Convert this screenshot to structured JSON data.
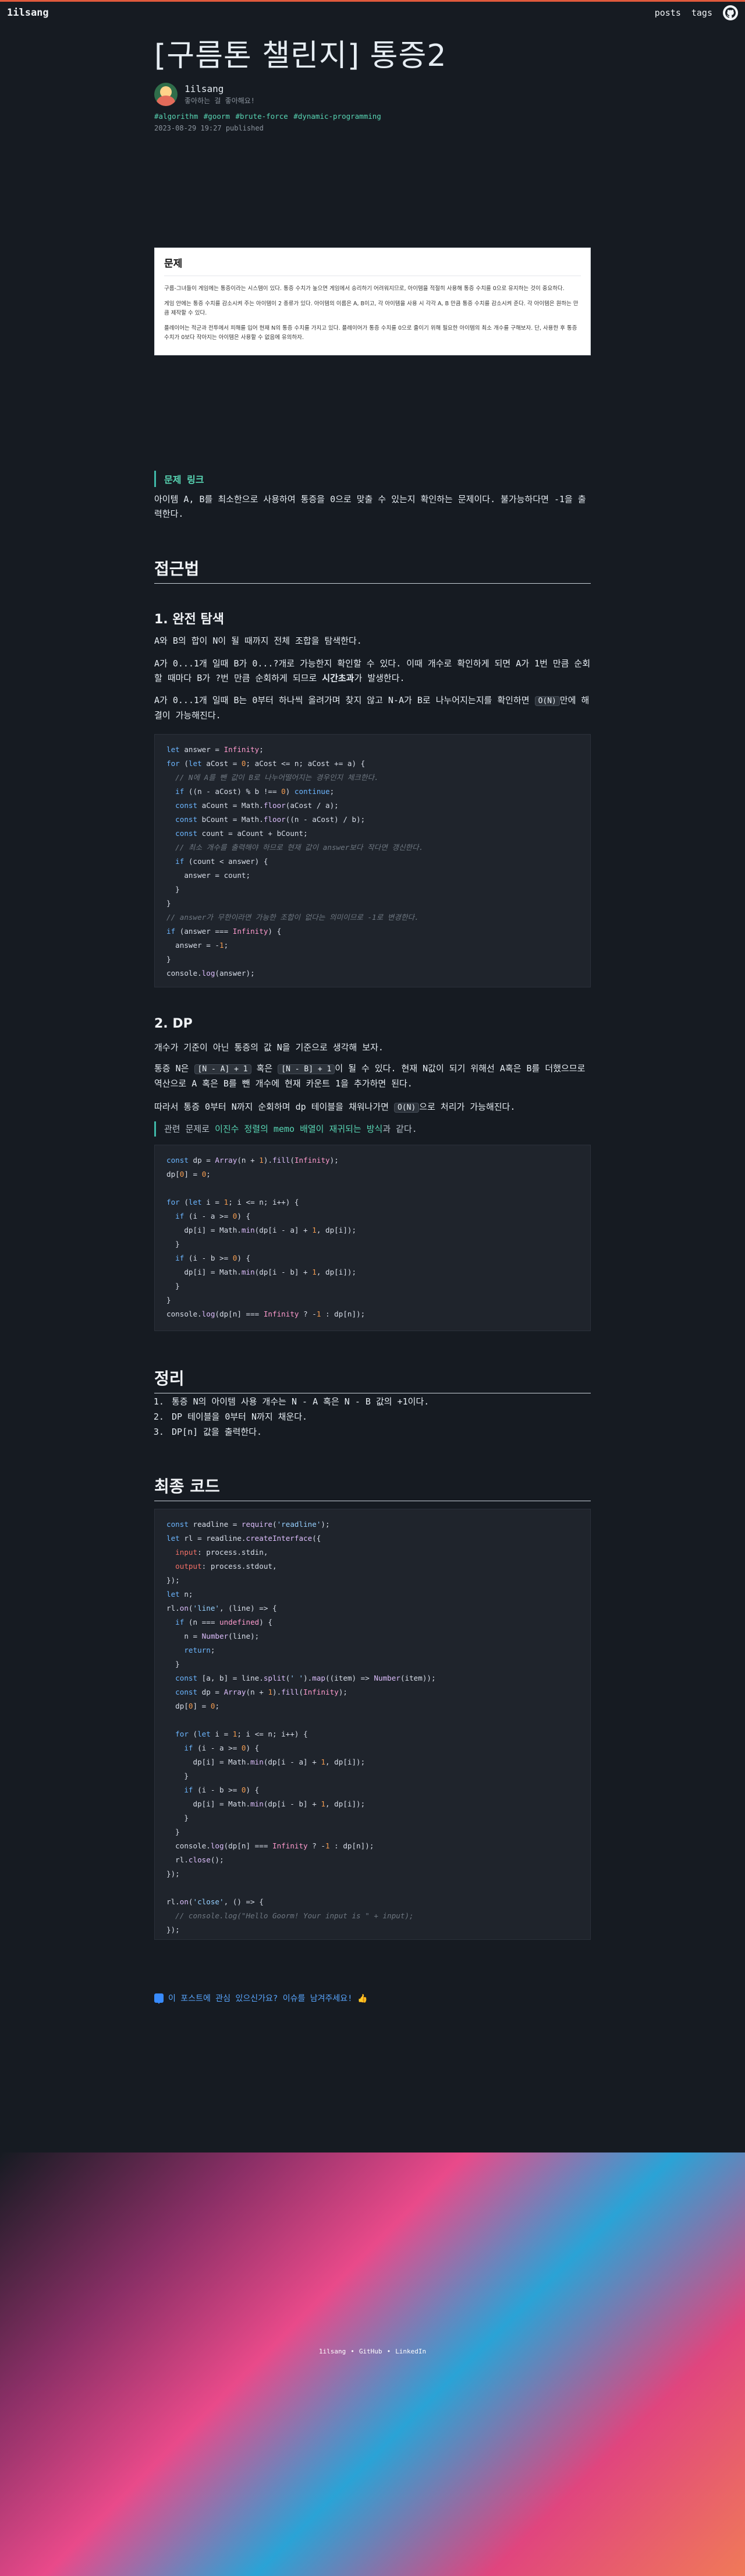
{
  "header": {
    "logo": "1ilsang",
    "nav": [
      "posts",
      "tags"
    ]
  },
  "post": {
    "title": "[구름톤 챌린지] 통증2",
    "author": "1ilsang",
    "author_sub": "좋아하는 걸 좋아해요!",
    "tags": "#algorithm #goorm #brute-force #dynamic-programming",
    "date": "2023-08-29 19:27 published"
  },
  "problem_image": {
    "heading": "문제",
    "paragraphs": [
      "구름-그녀들이 게임에는 통증이라는 시스템이 있다. 통증 수치가 높으면 게임에서 승리하기 어려워지므로, 아이템을 적절히 사용해 통증 수치를 0으로 유지하는 것이 중요하다.",
      "게임 안에는 통증 수치를 감소시켜 주는 아이템이 2 종류가 있다. 아이템의 이름은 A, B이고, 각 아이템을 사용 시 각각 A, B 만큼 통증 수치를 감소시켜 준다. 각 아이템은 원하는 만큼 제작할 수 있다.",
      "플레이어는 적군과 전투에서 피해를 입어 현재 N의 통증 수치를 가지고 있다. 플레이어가 통증 수치를 0으로 줄이기 위해 필요한 아이템의 최소 개수를 구해보자. 단, 사용한 후 통증 수치가 0보다 작아지는 아이템은 사용할 수 없음에 유의하자."
    ]
  },
  "problem_link": "문제 링크",
  "intro": "아이템 A, B를 최소한으로 사용하여 통증을 0으로 맞출 수 있는지 확인하는 문제이다. 불가능하다면 -1을 출력한다.",
  "approach": {
    "heading": "접근법",
    "brute": {
      "heading": "1. 완전 탐색",
      "p1": "A와 B의 합이 N이 될 때까지 전체 조합을 탐색한다.",
      "p2a": "A가 0...1개 일때 B가 0...?개로 가능한지 확인할 수 있다. 이때 개수로 확인하게 되면 A가 1번 만큼 순회할 때마다 B가 ?번 만큼 순회하게 되므로 ",
      "p2b": "시간초과",
      "p2c": "가 발생한다.",
      "p3a": "A가 0...1개 일때 B는 0부터 하나씩 올려가며 찾지 않고 N-A가 B로 나누어지는지를 확인하면 ",
      "p3code": "O(N)",
      "p3b": "만에 해결이 가능해진다."
    },
    "dp": {
      "heading": "2. DP",
      "p1": "개수가 기준이 아닌 통증의 값 N을 기준으로 생각해 보자.",
      "p2a": "통증 N은 ",
      "p2code1": "[N - A] + 1",
      "p2b": " 혹은 ",
      "p2code2": "[N - B] + 1",
      "p2c": "이 될 수 있다. 현재 N값이 되기 위해선 A혹은 B를 더했으므로 역산으로 A 혹은 B를 뺀 개수에 현재 카운트 1을 추가하면 된다.",
      "p3a": "따라서 통증 0부터 N까지 순회하며 dp 테이블을 채워나가면 ",
      "p3code": "O(N)",
      "p3b": "으로 처리가 가능해진다.",
      "quote_a": "관련 문제로 ",
      "quote_b": "이진수 정렬의 memo 배열이 재귀되는 방식",
      "quote_c": "과 같다."
    }
  },
  "summary": {
    "heading": "정리",
    "items": [
      "통증 N의 아이템 사용 개수는 N - A 혹은 N - B 값의 +1이다.",
      "DP 테이블을 0부터 N까지 채운다.",
      "DP[n] 값을 출력한다."
    ]
  },
  "final_code_heading": "최종 코드",
  "feedback": "이 포스트에 관심 있으신가요? 이슈를 남겨주세요! 👍",
  "footer": {
    "links": [
      "1ilsang",
      "GitHub",
      "LinkedIn"
    ],
    "sep": "•"
  }
}
